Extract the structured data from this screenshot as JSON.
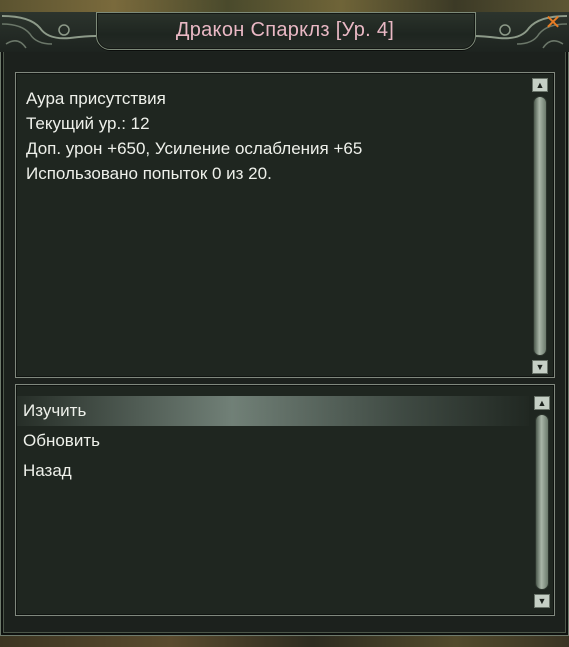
{
  "dialog": {
    "title": "Дракон Спарклз [Ур. 4]",
    "close_icon": "close-icon",
    "accent_color": "#e87c24",
    "title_color": "#e9b8c4"
  },
  "info": {
    "lines": [
      "Аура присутствия",
      "Текущий ур.: 12",
      "Доп. урон +650, Усиление ослабления +65",
      "Использовано попыток 0 из 20."
    ]
  },
  "menu": {
    "options": [
      {
        "label": "Изучить",
        "highlighted": true
      },
      {
        "label": "Обновить",
        "highlighted": false
      },
      {
        "label": "Назад",
        "highlighted": false
      }
    ]
  },
  "scrollbars": {
    "up_icon": "scroll-up-arrow-icon",
    "down_icon": "scroll-down-arrow-icon",
    "up_glyph": "▲",
    "down_glyph": "▼"
  }
}
